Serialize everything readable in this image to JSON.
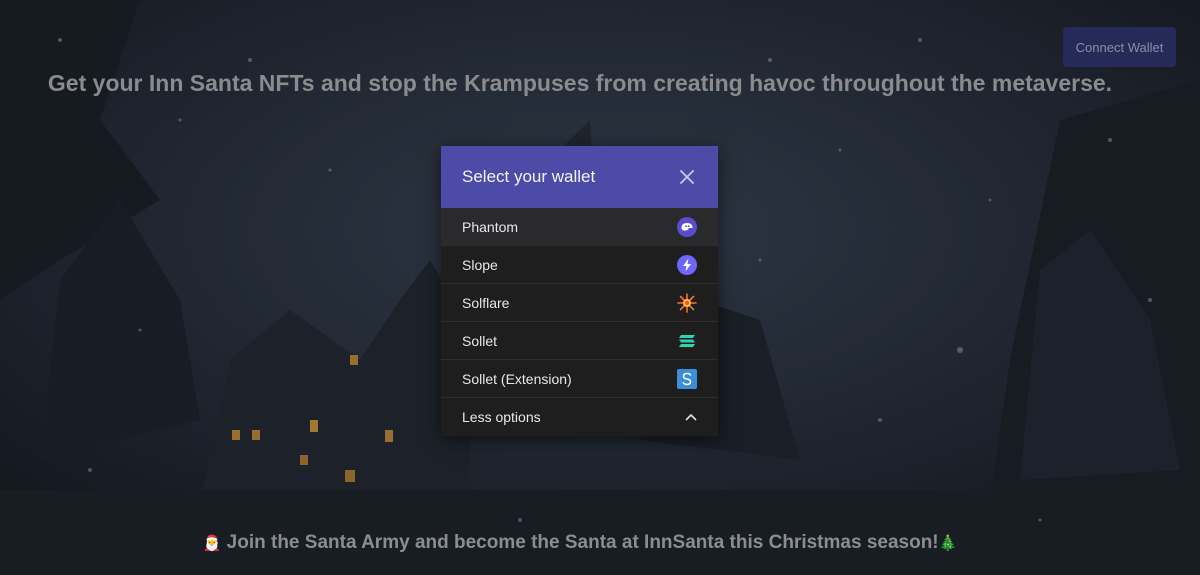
{
  "header": {
    "headline": "Get your Inn Santa NFTs and stop the Krampuses from creating havoc throughout the metaverse.",
    "connect_wallet_label": "Connect Wallet"
  },
  "modal": {
    "title": "Select your wallet",
    "close_icon": "close-icon",
    "wallets": [
      {
        "label": "Phantom",
        "icon": "phantom-icon"
      },
      {
        "label": "Slope",
        "icon": "slope-icon"
      },
      {
        "label": "Solflare",
        "icon": "solflare-icon"
      },
      {
        "label": "Sollet",
        "icon": "sollet-icon"
      },
      {
        "label": "Sollet (Extension)",
        "icon": "sollet-extension-icon"
      }
    ],
    "less_options_label": "Less options",
    "chevron_icon": "chevron-up-icon"
  },
  "footer": {
    "prefix_emoji": "🎅",
    "text": " Join the Santa Army and become the Santa at InnSanta this Christmas season!",
    "suffix_emoji": "🎄"
  },
  "colors": {
    "modal_header": "#4c4ca8",
    "modal_body": "#1e1e1f",
    "connect_button": "#262a58",
    "phantom": "#5b4ccf",
    "slope": "#6e66fa",
    "solflare": "#fc7227",
    "sollet": "#2bd8a7",
    "sollet_extension": "#3b8fd9"
  }
}
